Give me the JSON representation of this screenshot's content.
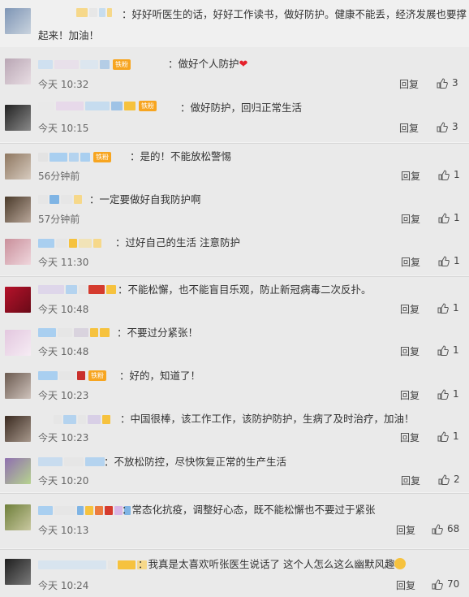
{
  "top_comment": {
    "text1": "：好好听医生的话，好好工作读书，做好防护。健康不能丢，经济发展也要撑",
    "text2": "起来！加油！"
  },
  "badge_label": "铁粉",
  "actions": {
    "reply_label": "回复"
  },
  "comments": [
    {
      "text": "：做好个人防护",
      "time": "今天 10:32",
      "likes": "3"
    },
    {
      "text": "：做好防护，回归正常生活",
      "time": "今天 10:15",
      "likes": "3"
    },
    {
      "text": "：是的！不能放松警惕",
      "time": "56分钟前",
      "likes": "1"
    },
    {
      "text": "：一定要做好自我防护啊",
      "time": "57分钟前",
      "likes": "1"
    },
    {
      "text": "：过好自己的生活  注意防护",
      "time": "今天 11:30",
      "likes": "1"
    },
    {
      "text": "：不能松懈，也不能盲目乐观，防止新冠病毒二次反扑。",
      "time": "今天 10:48",
      "likes": "1"
    },
    {
      "text": "：不要过分紧张！",
      "time": "今天 10:48",
      "likes": "1"
    },
    {
      "text": "：好的，知道了！",
      "time": "今天 10:23",
      "likes": "1"
    },
    {
      "text": "：中国很棒，该工作工作，该防护防护，生病了及时治疗，加油！",
      "time": "今天 10:23",
      "likes": "1"
    },
    {
      "text": "：不放松防控，尽快恢复正常的生产生活",
      "time": "今天 10:20",
      "likes": "2"
    },
    {
      "text": "：常态化抗疫，调整好心态，既不能松懈也不要过于紧张",
      "time": "今天 10:13",
      "likes": "68"
    },
    {
      "text": "：我真是太喜欢听张医生说话了  这个人怎么这么幽默风趣",
      "time": "今天 10:24",
      "likes": "70"
    }
  ],
  "icons": {
    "like": "thumbs-up-icon",
    "heart": "heart-icon",
    "badge": "fan-badge-icon",
    "emoji": "laughing-emoji-icon"
  },
  "colors": {
    "badge": "#f7a520",
    "heart": "#e5212b",
    "card": "#eaeaea"
  }
}
